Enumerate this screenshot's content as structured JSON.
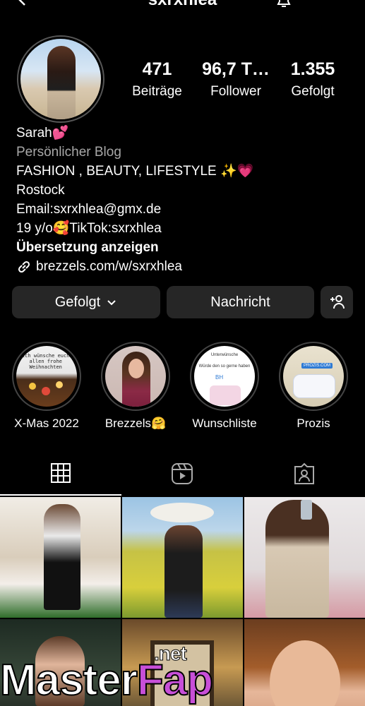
{
  "profile": {
    "username": "sxrxhlea",
    "stats": [
      {
        "value": "471",
        "label": "Beiträge"
      },
      {
        "value": "96,7 T…",
        "label": "Follower"
      },
      {
        "value": "1.355",
        "label": "Gefolgt"
      }
    ],
    "display_name": "Sarah💕",
    "category": "Persönlicher Blog",
    "bio_lines": [
      "FASHION , BEAUTY, LIFESTYLE ✨💗",
      "Rostock",
      "Email:sxrxhlea@gmx.de",
      "19 y/o🥰TikTok:sxrxhlea"
    ],
    "translate": "Übersetzung anzeigen",
    "link": "brezzels.com/w/sxrxhlea"
  },
  "actions": {
    "following": "Gefolgt",
    "message": "Nachricht"
  },
  "highlights": [
    {
      "label": "X-Mas 2022"
    },
    {
      "label": "Brezzels🤗"
    },
    {
      "label": "Wunschliste"
    },
    {
      "label": "Prozis"
    }
  ],
  "highlight_text": {
    "xmas": [
      "Ich wünsche euch",
      "allen frohe",
      "Weihnachten"
    ],
    "wish_title": "Unterwünsche",
    "wish_body": "Würde den so gerne haben",
    "wish_tag": "BH",
    "prozis_tag": "PROZIS.COM"
  },
  "tabs": [
    {
      "icon": "grid-icon"
    },
    {
      "icon": "reels-icon"
    },
    {
      "icon": "tagged-icon"
    }
  ],
  "watermark": {
    "main1": "Master",
    "main2": "Fap",
    "suffix": ".net"
  },
  "colors": {
    "background": "#000000",
    "button": "#262626",
    "muted": "#a8a8a8",
    "watermark_pink": "#c84fd8"
  }
}
